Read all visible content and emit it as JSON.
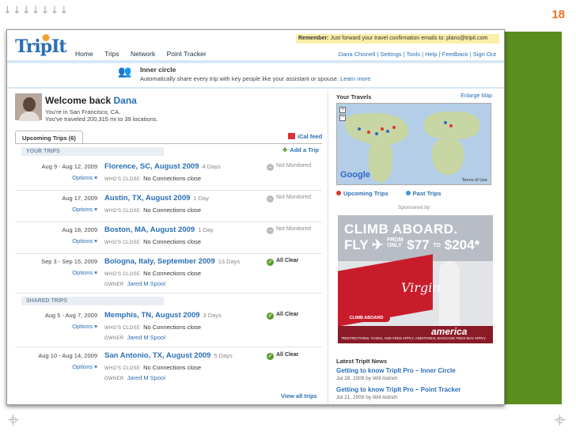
{
  "slide": {
    "arrows": "↓↓↓↓↓↓↓",
    "number": "18",
    "accent": "#e8731e",
    "side_color": "#5a8f1f"
  },
  "tripit": {
    "logo": "TripIt",
    "remember": "Remember:",
    "remember_text": "Just forward your travel confirmation emails to: plans@tripit.com",
    "nav": [
      "Home",
      "Trips",
      "Network",
      "Point Tracker"
    ],
    "user_links": "Dana Chisnell | Settings | Tools | Help | Feedback | Sign Out",
    "inner_circle": {
      "title": "Inner circle",
      "desc": "Automatically share every trip with key people like your assistant or spouse.",
      "learn_more": "Learn more"
    },
    "welcome": "Welcome back",
    "user": "Dana",
    "location": "You're in San Francisco, CA.",
    "traveled": "You've traveled 200,315 mi to 39 locations.",
    "upcoming_tab": "Upcoming Trips (6)",
    "ical": "iCal feed",
    "add_trip": "Add a Trip",
    "your_trips": "YOUR TRIPS",
    "shared_trips": "SHARED TRIPS",
    "whos_close": "WHO'S CLOSE",
    "owner": "OWNER",
    "options": "Options ▾",
    "trips": [
      {
        "dates": "Aug 9 - Aug 12, 2009",
        "name": "Florence, SC, August 2009",
        "days": "4 Days",
        "close": "No Connections close",
        "status": "Not Monitored"
      },
      {
        "dates": "Aug 17, 2009",
        "name": "Austin, TX, August 2009",
        "days": "1 Day",
        "close": "No Connections close",
        "status": "Not Monitored"
      },
      {
        "dates": "Aug 18, 2009",
        "name": "Boston, MA, August 2009",
        "days": "1 Day",
        "close": "No Connections close",
        "status": "Not Monitored"
      },
      {
        "dates": "Sep 3 - Sep 15, 2009",
        "name": "Bologna, Italy, September 2009",
        "days": "13 Days",
        "close": "No Connections close",
        "owner": "Jared M Spool",
        "status": "All Clear"
      },
      {
        "dates": "Aug 5 - Aug 7, 2009",
        "name": "Memphis, TN, August 2009",
        "days": "3 Days",
        "close": "No Connections close",
        "owner": "Jared M Spool",
        "status": "All Clear"
      },
      {
        "dates": "Aug 10 - Aug 14, 2009",
        "name": "San Antonio, TX, August 2009",
        "days": "5 Days",
        "close": "No Connections close",
        "owner": "Jared M Spool",
        "status": "All Clear"
      }
    ],
    "view_all": "View all trips",
    "your_travels": "Your Travels",
    "enlarge_map": "Enlarge Map",
    "powered_by": "POWERED BY",
    "google": "Google",
    "terms": "Terms of Use",
    "legend_upcoming": "Upcoming Trips",
    "legend_past": "Past Trips",
    "sponsored": "Sponsored by:",
    "ad": {
      "line1": "CLIMB ABOARD.",
      "fly": "FLY",
      "from": "FROM",
      "only": "ONLY",
      "price1": "$77",
      "to": "TO",
      "price2": "$204*",
      "button": "CLIMB ABOARD",
      "virgin": "Virgin",
      "america": "america",
      "fine": "*RESTRICTIONS, TAXES, AND FEES APPLY. ADDITIONAL BAGGAGE FEES MAY APPLY."
    },
    "news_head": "Latest TripIt News",
    "news": [
      {
        "title": "Getting to know TripIt Pro – Inner Circle",
        "meta": "Jul 28, 2009 by Will Aldrich"
      },
      {
        "title": "Getting to know TripIt Pro – Point Tracker",
        "meta": "Jul 21, 2009 by Will Aldrich"
      }
    ]
  }
}
